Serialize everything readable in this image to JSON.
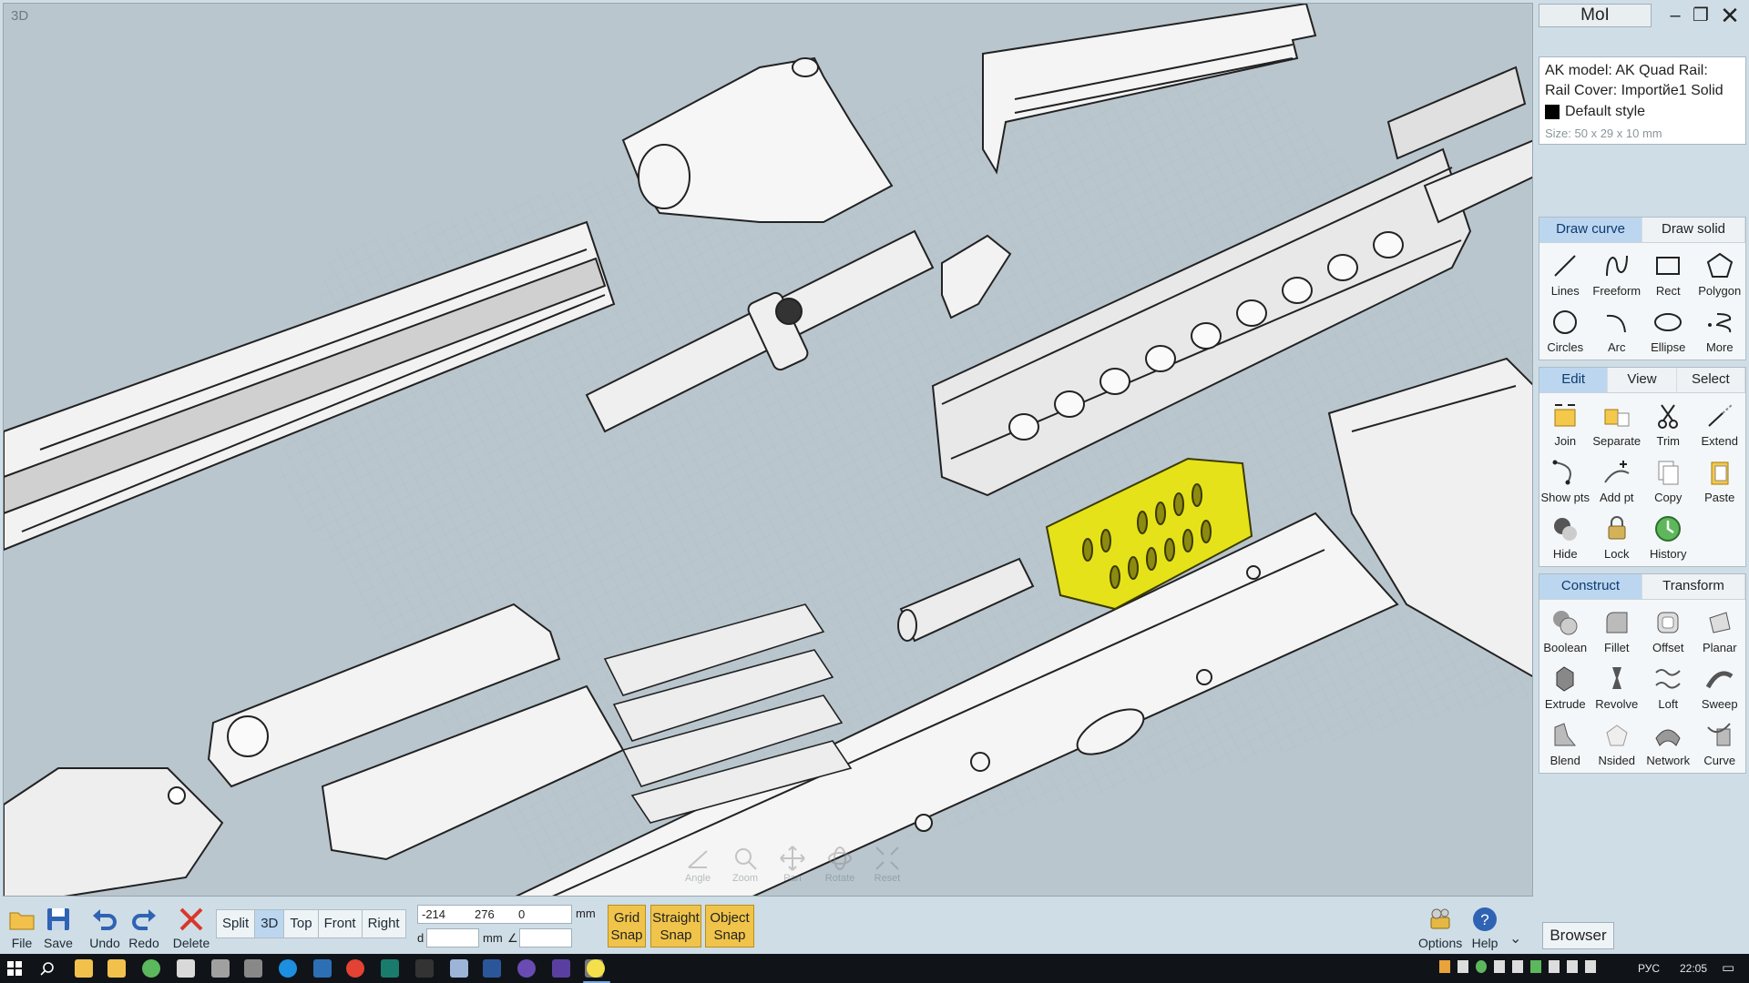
{
  "viewport": {
    "label": "3D",
    "nav_hints": [
      "Angle",
      "Zoom",
      "Pan",
      "Rotate",
      "Reset"
    ]
  },
  "window": {
    "title": "MoI"
  },
  "info": {
    "line1": "AK model: AK Quad Rail:",
    "line2": "Rail Cover: Importйe1  Solid",
    "style": "Default style",
    "size": "Size: 50 x 29 x 10 mm"
  },
  "draw": {
    "tabs": [
      "Draw curve",
      "Draw solid"
    ],
    "tools": [
      "Lines",
      "Freeform",
      "Rect",
      "Polygon",
      "Circles",
      "Arc",
      "Ellipse",
      "More"
    ]
  },
  "edit": {
    "tabs": [
      "Edit",
      "View",
      "Select"
    ],
    "tools": [
      "Join",
      "Separate",
      "Trim",
      "Extend",
      "Show pts",
      "Add pt",
      "Copy",
      "Paste",
      "Hide",
      "Lock",
      "History"
    ]
  },
  "construct": {
    "tabs": [
      "Construct",
      "Transform"
    ],
    "tools": [
      "Boolean",
      "Fillet",
      "Offset",
      "Planar",
      "Extrude",
      "Revolve",
      "Loft",
      "Sweep",
      "Blend",
      "Nsided",
      "Network",
      "Curve"
    ]
  },
  "bottom": {
    "file": "File",
    "save": "Save",
    "undo": "Undo",
    "redo": "Redo",
    "delete": "Delete",
    "views": [
      "Split",
      "3D",
      "Top",
      "Front",
      "Right"
    ],
    "coords": {
      "x": "-214",
      "y": "276",
      "z": "0",
      "unit": "mm",
      "d_label": "d",
      "d_unit": "mm",
      "angle_label": "∠"
    },
    "grid_snap": [
      "Grid",
      "Snap"
    ],
    "straight_snap": [
      "Straight",
      "Snap"
    ],
    "object_snap": [
      "Object",
      "Snap"
    ],
    "options": "Options",
    "help": "Help",
    "browser": "Browser"
  },
  "taskbar": {
    "lang": "РУС",
    "time": "22:05"
  },
  "colors": {
    "panel_bg": "#cfdde6",
    "active_tab": "#bcd6ef",
    "snap": "#f0c44a",
    "selected_part": "#e6e21a"
  }
}
